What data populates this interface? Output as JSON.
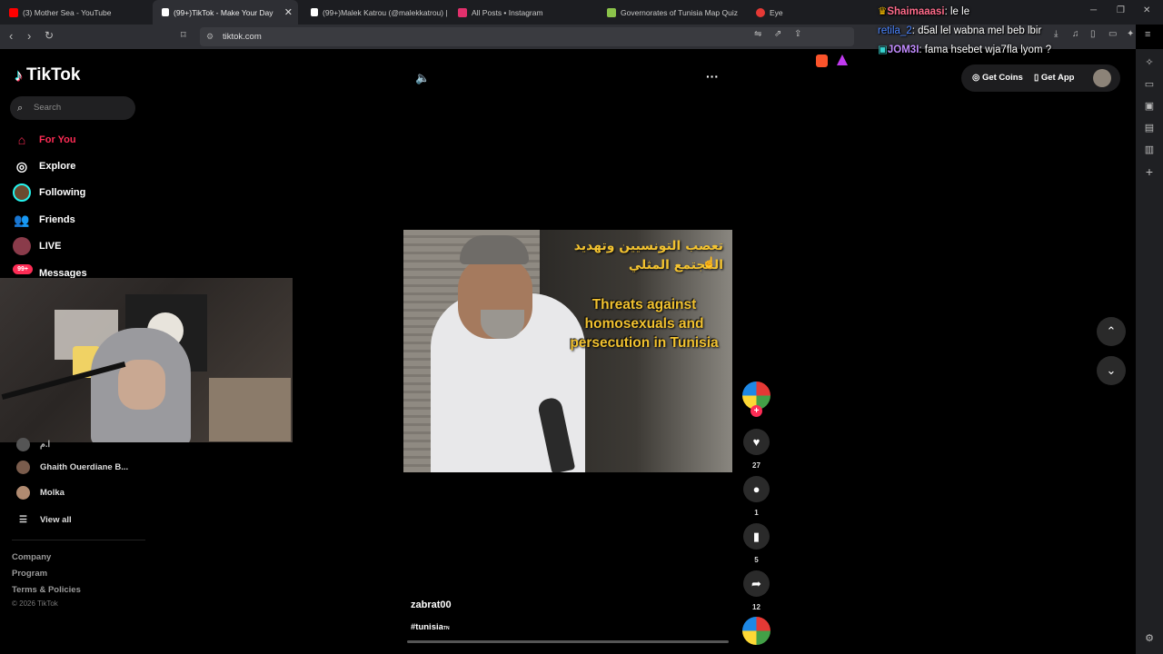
{
  "browser": {
    "tabs": [
      {
        "label": "(3) Mother Sea - YouTube",
        "active": false,
        "favicon_color": "#ff0000"
      },
      {
        "label": "(99+)TikTok - Make Your Day",
        "active": true,
        "favicon_color": "#ffffff"
      },
      {
        "label": "(99+)Malek Katrou (@malekkatrou) |",
        "active": false,
        "favicon_color": "#ffffff"
      },
      {
        "label": "All Posts • Instagram",
        "active": false,
        "favicon_color": "#e1306c"
      },
      {
        "label": "Governorates of Tunisia Map Quiz",
        "active": false,
        "favicon_color": "#8bc34a"
      },
      {
        "label": "Eye",
        "active": false,
        "favicon_color": "#e53935"
      }
    ],
    "url": "tiktok.com"
  },
  "chat": [
    {
      "user": "Shaimaaasi",
      "message": ": le le"
    },
    {
      "user": "retila_2",
      "message": ": d5al lel wabna mel beb lbir"
    },
    {
      "user": "JOM3I",
      "message": ": fama hsebet wja7fla lyom ?"
    }
  ],
  "tiktok": {
    "brand": "TikTok",
    "search_placeholder": "Search",
    "nav": {
      "for_you": "For You",
      "explore": "Explore",
      "following": "Following",
      "friends": "Friends",
      "live": "LIVE",
      "messages": "Messages",
      "messages_badge": "99+"
    },
    "following_accounts": [
      {
        "name": "Ghaith Ouerdiane B..."
      },
      {
        "name": "Molka"
      }
    ],
    "partial_account": "ا.م",
    "view_all": "View all",
    "footer": {
      "company": "Company",
      "program": "Program",
      "terms": "Terms & Policies",
      "copyright": "© 2026 TikTok"
    },
    "top_actions": {
      "get_coins": "Get Coins",
      "get_app": "Get App"
    },
    "video": {
      "caption_arabic": "تعصب التونسيين وتهديد المجتمع المثلي",
      "caption_english": "Threats against homosexuals and persecution in Tunisia",
      "author": "zabrat00",
      "hashtag": "#tunisia",
      "hashtag_flag": "TN",
      "likes": "27",
      "comments": "1",
      "saves": "5",
      "shares": "12"
    }
  },
  "colors": {
    "accent": "#fe2c55",
    "caption": "#f2c230"
  }
}
